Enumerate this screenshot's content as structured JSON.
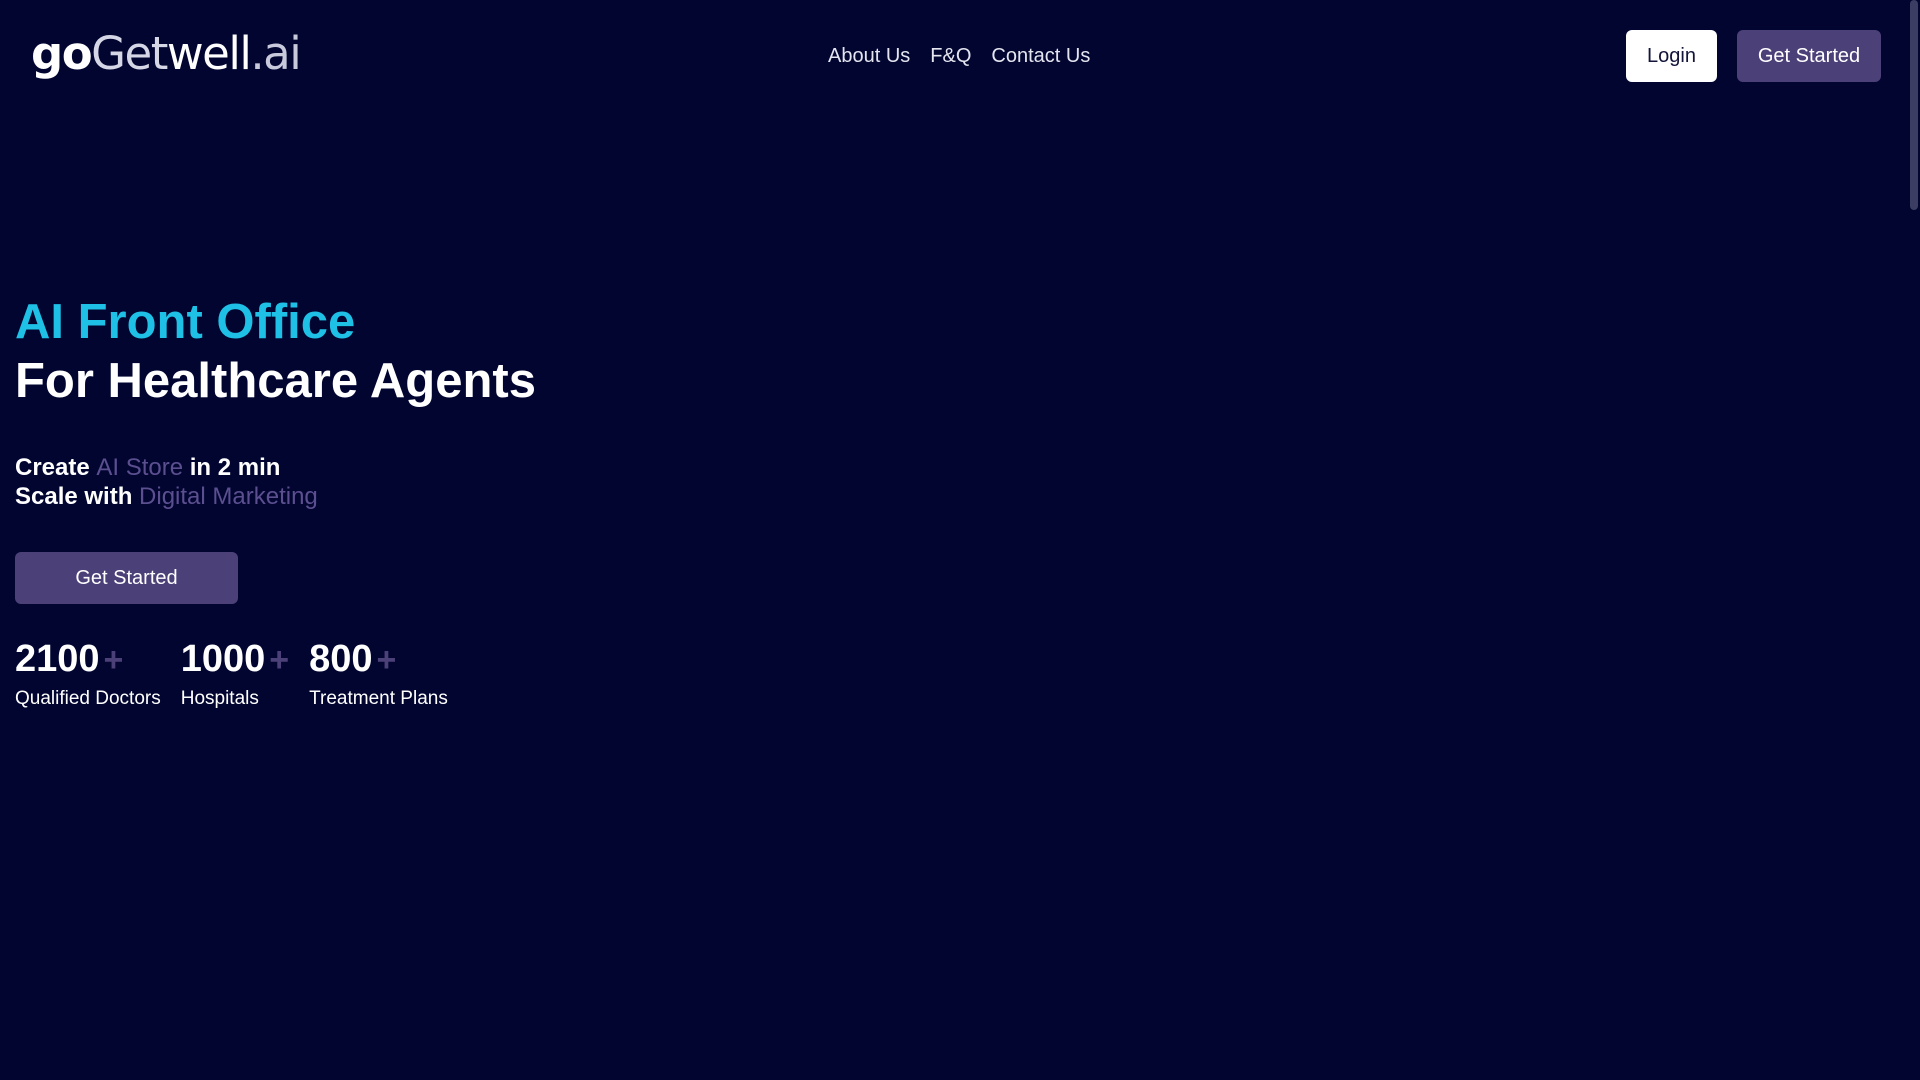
{
  "header": {
    "logo": {
      "part_go": "go",
      "part_get": "Get",
      "part_well": "well",
      "part_ai": ".ai"
    },
    "nav": [
      {
        "label": "About Us"
      },
      {
        "label": "F&Q"
      },
      {
        "label": "Contact Us"
      }
    ],
    "login_label": "Login",
    "get_started_label": "Get Started"
  },
  "hero": {
    "title_line1": "AI Front Office",
    "title_line2": "For Healthcare Agents",
    "sub1": {
      "prefix": "Create ",
      "highlight": "AI Store",
      "suffix": " in 2 min"
    },
    "sub2": {
      "prefix": "Scale with ",
      "highlight": "Digital Marketing"
    },
    "cta_label": "Get Started"
  },
  "stats": [
    {
      "value": "2100",
      "plus": "+",
      "label": "Qualified Doctors"
    },
    {
      "value": "1000",
      "plus": "+",
      "label": "Hospitals"
    },
    {
      "value": "800",
      "plus": "+",
      "label": "Treatment Plans"
    }
  ],
  "colors": {
    "background": "#010530",
    "accent_cyan": "#1ec0e6",
    "accent_purple": "#4c4079",
    "highlight_text": "#5b4f90"
  }
}
